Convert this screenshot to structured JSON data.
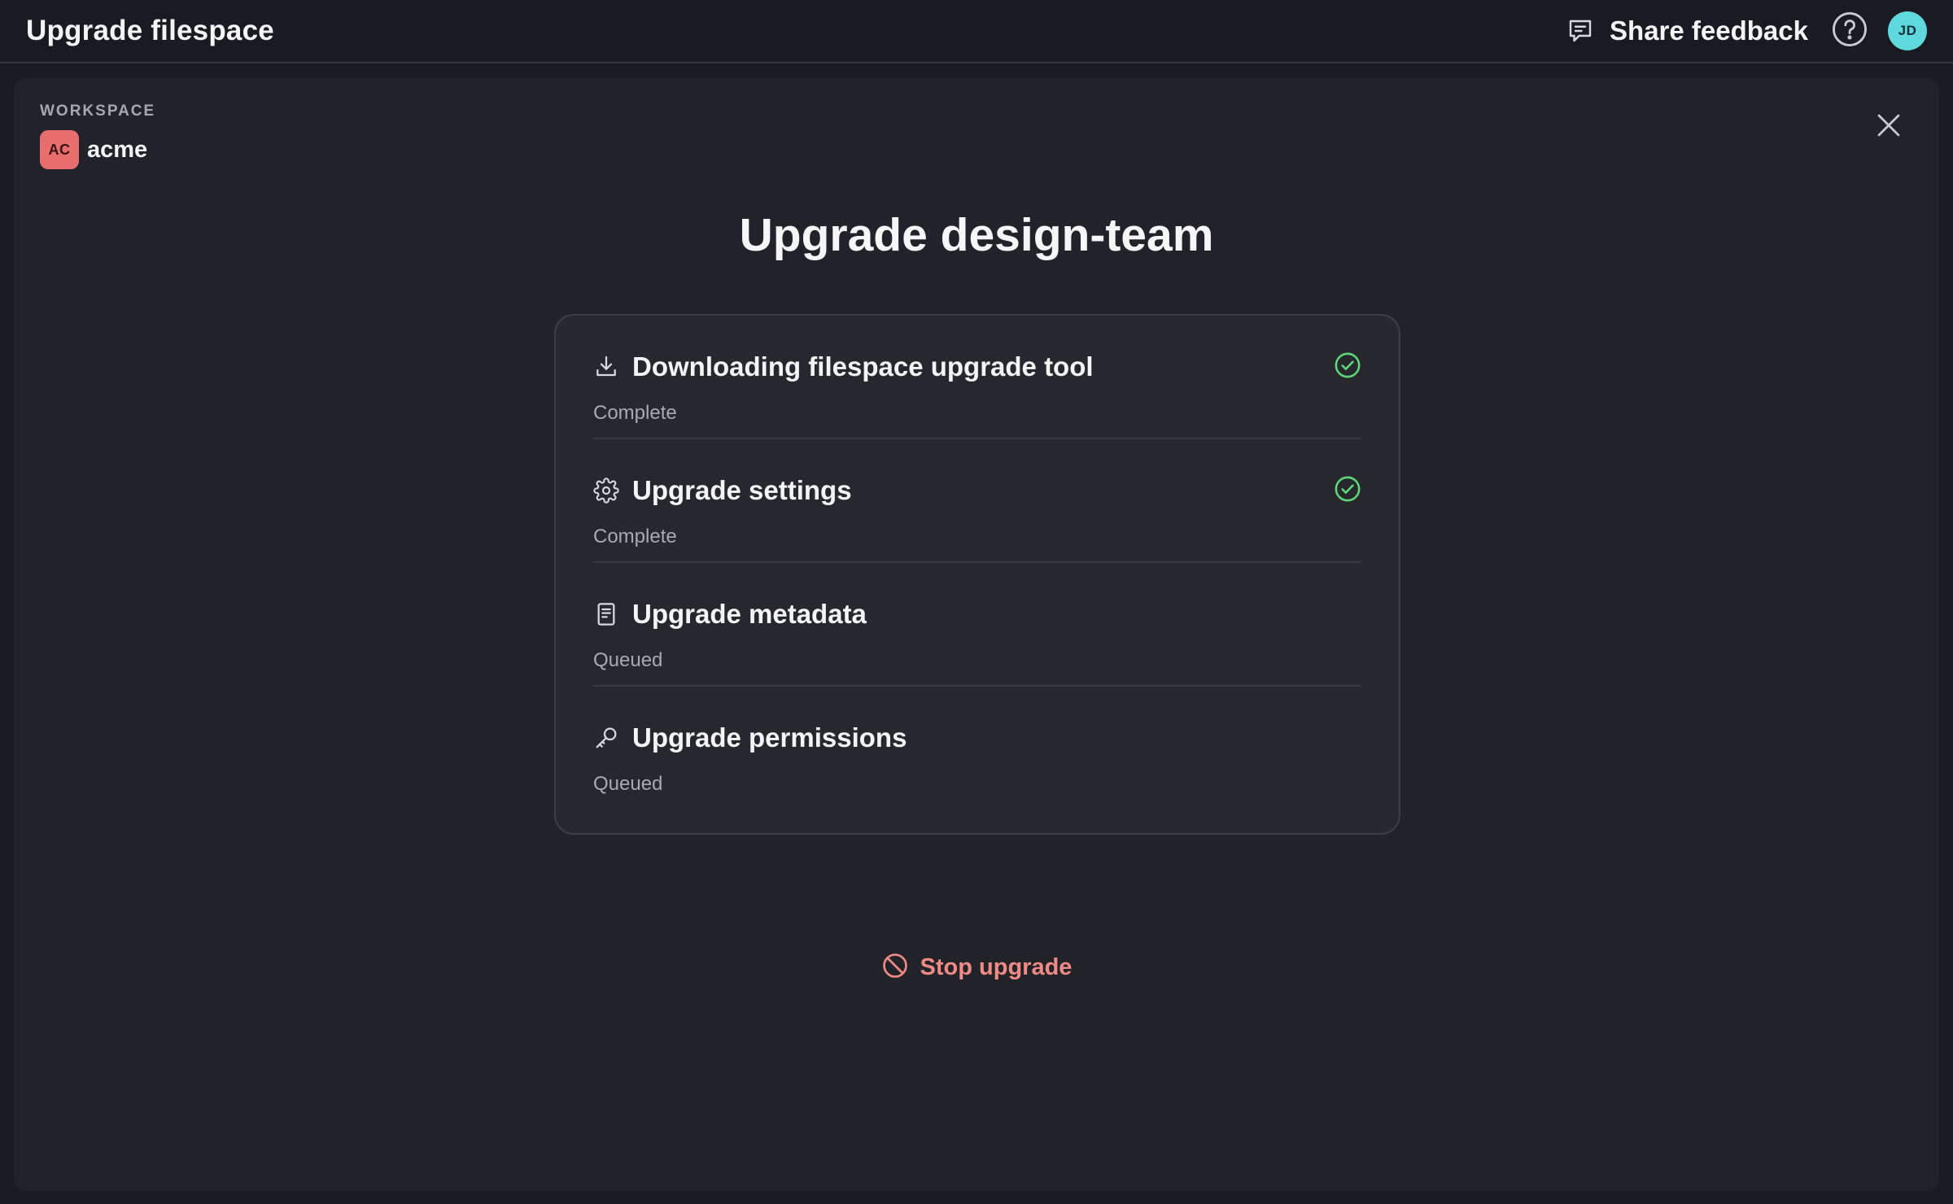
{
  "topbar": {
    "title": "Upgrade filespace",
    "feedback_label": "Share feedback",
    "feedback_icon": "chat-feedback-icon",
    "help_icon": "help-icon",
    "avatar_initials": "JD",
    "avatar_color": "#5fd9dd"
  },
  "workspace": {
    "label": "WORKSPACE",
    "badge": "AC",
    "badge_color": "#e86d6d",
    "name": "acme"
  },
  "main": {
    "title": "Upgrade design-team",
    "steps": [
      {
        "icon": "download-icon",
        "title": "Downloading filespace upgrade tool",
        "status": "Complete",
        "done": true
      },
      {
        "icon": "gear-icon",
        "title": "Upgrade settings",
        "status": "Complete",
        "done": true
      },
      {
        "icon": "document-icon",
        "title": "Upgrade metadata",
        "status": "Queued",
        "done": false
      },
      {
        "icon": "key-icon",
        "title": "Upgrade permissions",
        "status": "Queued",
        "done": false
      }
    ],
    "stop_label": "Stop upgrade",
    "stop_icon": "prohibited-icon"
  },
  "colors": {
    "success": "#5ed67a",
    "danger": "#f08a86",
    "background": "#1a1b20",
    "panel": "#222328"
  }
}
